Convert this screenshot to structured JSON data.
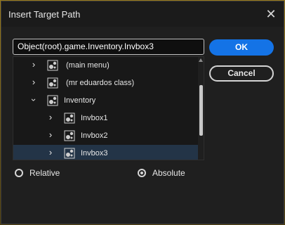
{
  "dialog": {
    "title": "Insert Target Path",
    "close_icon": "close-icon"
  },
  "path_input": {
    "value": "Object(root).game.Inventory.Invbox3"
  },
  "buttons": {
    "ok_label": "OK",
    "cancel_label": "Cancel"
  },
  "tree": {
    "items": [
      {
        "label": "(main menu)",
        "expanded": false,
        "icon": "movieclip-icon"
      },
      {
        "label": "(mr eduardos class)",
        "expanded": false,
        "icon": "movieclip-icon"
      },
      {
        "label": "Inventory",
        "expanded": true,
        "icon": "movieclip-icon"
      },
      {
        "label": "Invbox1",
        "expanded": false,
        "icon": "movieclip-icon"
      },
      {
        "label": "Invbox2",
        "expanded": false,
        "icon": "movieclip-icon"
      },
      {
        "label": "Invbox3",
        "expanded": false,
        "icon": "movieclip-icon",
        "selected": true
      }
    ]
  },
  "options": {
    "relative_label": "Relative",
    "absolute_label": "Absolute",
    "selected": "Absolute"
  },
  "colors": {
    "accent": "#1473e6",
    "selection": "#233447"
  }
}
